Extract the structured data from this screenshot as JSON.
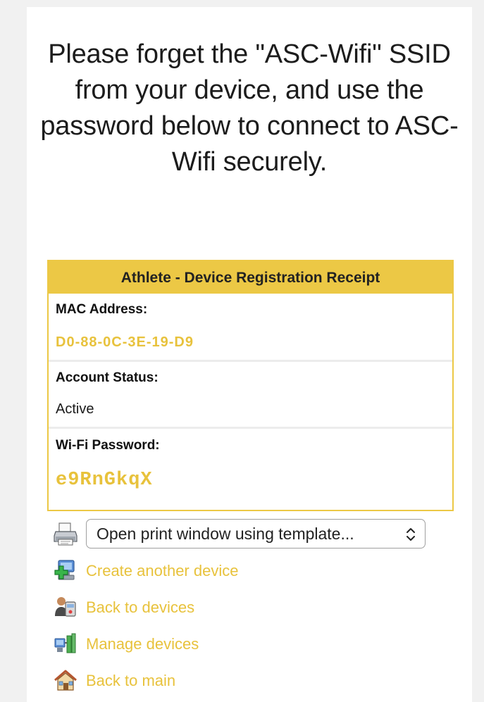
{
  "heading": "Please forget the \"ASC-Wifi\" SSID from your device, and use the password below to connect to ASC-Wifi securely.",
  "receipt": {
    "title": "Athlete - Device Registration Receipt",
    "mac_label": "MAC Address:",
    "mac_value": "D0-88-0C-3E-19-D9",
    "status_label": "Account Status:",
    "status_value": "Active",
    "password_label": "Wi-Fi Password:",
    "password_value": "e9RnGkqX"
  },
  "print": {
    "icon": "printer-icon",
    "select_value": "Open print window using template..."
  },
  "links": [
    {
      "label": "Create another device",
      "icon": "add-device-icon"
    },
    {
      "label": "Back to devices",
      "icon": "devices-icon"
    },
    {
      "label": "Manage devices",
      "icon": "network-devices-icon"
    },
    {
      "label": "Back to main",
      "icon": "home-icon"
    }
  ],
  "colors": {
    "accent": "#ecc845",
    "link": "#e8c23c",
    "page_bg": "#f1f1f1"
  }
}
